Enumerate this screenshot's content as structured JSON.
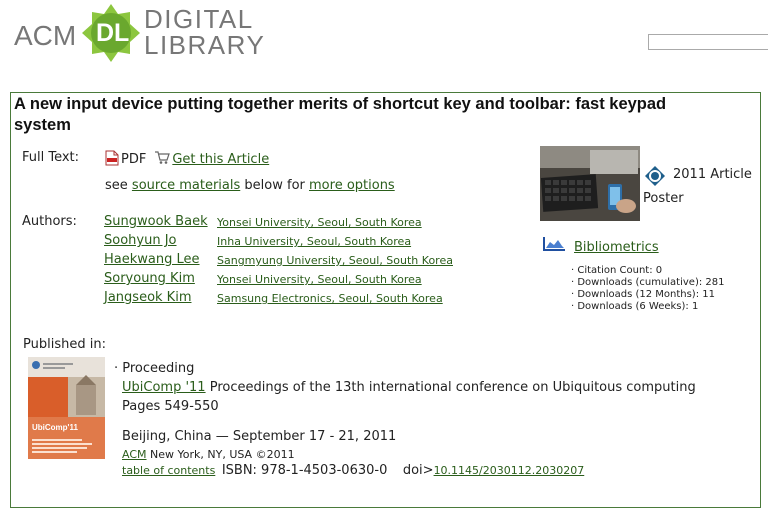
{
  "header": {
    "logo_acm": "ACM",
    "logo_badge": "DL",
    "logo_line1": "DIGITAL",
    "logo_line2": "LIBRARY",
    "search_value": ""
  },
  "article": {
    "title": "A new input device putting together merits of shortcut key and toolbar: fast keypad system",
    "full_text_label": "Full Text:",
    "pdf_label": "PDF",
    "get_article_link": "Get this Article",
    "see_prefix": "see",
    "source_materials_link": "source materials",
    "below_for": "below for",
    "more_options_link": "more options",
    "authors_label": "Authors:",
    "authors": [
      {
        "name": "Sungwook Baek",
        "affiliation": "Yonsei University, Seoul, South Korea"
      },
      {
        "name": "Soohyun Jo",
        "affiliation": "Inha University, Seoul, South Korea"
      },
      {
        "name": "Haekwang Lee",
        "affiliation": "Sangmyung University, Seoul, South Korea"
      },
      {
        "name": "Soryoung Kim",
        "affiliation": "Yonsei University, Seoul, South Korea"
      },
      {
        "name": "Jangseok Kim",
        "affiliation": "Samsung Electronics, Seoul, South Korea"
      }
    ]
  },
  "sidebar": {
    "article_year_type": "2011 Article",
    "poster_label": "Poster",
    "bibliometrics_link": "Bibliometrics",
    "stats": [
      "· Citation Count: 0",
      "· Downloads (cumulative): 281",
      "· Downloads (12 Months): 11",
      "· Downloads (6 Weeks): 1"
    ]
  },
  "published": {
    "label": "Published in:",
    "type": "· Proceeding",
    "conf_link": "UbiComp '11",
    "conf_title": "Proceedings of the 13th international conference on Ubiquitous computing",
    "pages": "Pages 549-550",
    "location_date": "Beijing, China — September 17 - 21, 2011",
    "publisher_link": "ACM",
    "publisher_info": "New York, NY, USA ©2011",
    "toc_link": "table of contents",
    "isbn": "ISBN: 978-1-4503-0630-0",
    "doi_label": "doi>",
    "doi_link": "10.1145/2030112.2030207",
    "cover_title": "UbiComp'11"
  },
  "colors": {
    "link": "#2a5d1a",
    "border": "#4a7a3a",
    "logo_gray": "#777777",
    "logo_green": "#6aa82e"
  }
}
